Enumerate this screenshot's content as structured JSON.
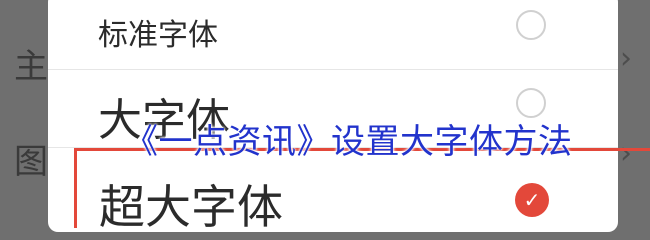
{
  "background": {
    "rows": [
      {
        "label": "主",
        "chevron": "›"
      },
      {
        "label": "图",
        "chevron": "›"
      }
    ]
  },
  "dialog": {
    "options": [
      {
        "label": "标准字体",
        "selected": false
      },
      {
        "label": "大字体",
        "selected": false
      },
      {
        "label": "超大字体",
        "selected": true
      }
    ],
    "check_glyph": "✓"
  },
  "caption": "《一点资讯》设置大字体方法",
  "colors": {
    "accent": "#e3483a",
    "caption": "#2233cc",
    "overlay": "#6f6f6f"
  }
}
